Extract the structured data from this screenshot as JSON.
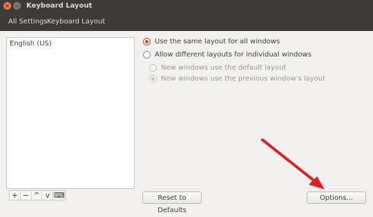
{
  "window": {
    "title": "Keyboard Layout"
  },
  "toolbar": {
    "all_settings": "All Settings",
    "current": "Keyboard Layout"
  },
  "layouts": {
    "items": [
      "English (US)"
    ]
  },
  "list_tools": {
    "add": "+",
    "remove": "−",
    "up": "^",
    "down": "v",
    "keyboard": "⌨"
  },
  "options": {
    "same_layout": "Use the same layout for all windows",
    "different_layout": "Allow different layouts for individual windows",
    "default_layout": "New windows use the default layout",
    "previous_layout": "New windows use the previous window's layout"
  },
  "buttons": {
    "reset": "Reset to Defaults",
    "options": "Options..."
  },
  "colors": {
    "accent": "#dd4814",
    "titlebar": "#3c3b37",
    "arrow": "#e02020"
  }
}
